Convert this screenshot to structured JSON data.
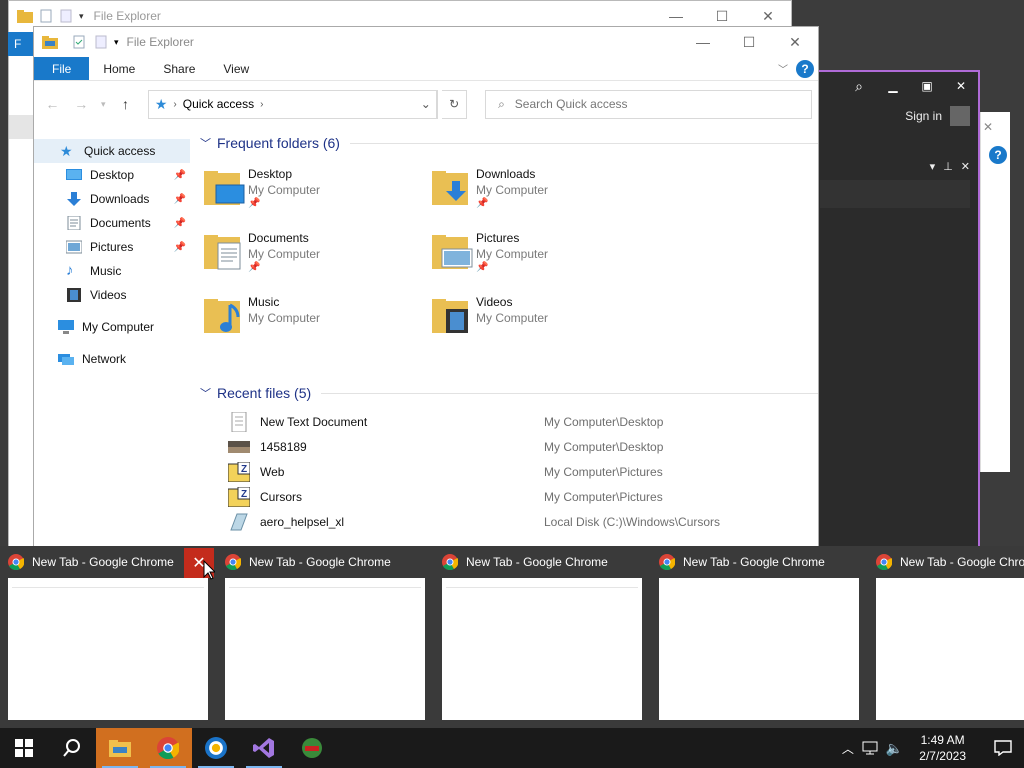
{
  "bg_window": {
    "title": "File Explorer",
    "ribbon_file_fragment": "F"
  },
  "dark_window": {
    "sign_in": "Sign in"
  },
  "window": {
    "title": "File Explorer"
  },
  "ribbon": {
    "tabs": [
      "File",
      "Home",
      "Share",
      "View"
    ]
  },
  "address": {
    "segment": "Quick access"
  },
  "search": {
    "placeholder": "Search Quick access"
  },
  "sidebar": {
    "quick_access": "Quick access",
    "items": [
      {
        "label": "Desktop",
        "icon": "desktop-icon",
        "pinned": true
      },
      {
        "label": "Downloads",
        "icon": "downloads-icon",
        "pinned": true
      },
      {
        "label": "Documents",
        "icon": "documents-icon",
        "pinned": true
      },
      {
        "label": "Pictures",
        "icon": "pictures-icon",
        "pinned": true
      },
      {
        "label": "Music",
        "icon": "music-icon",
        "pinned": false
      },
      {
        "label": "Videos",
        "icon": "videos-icon",
        "pinned": false
      }
    ],
    "my_computer": "My Computer",
    "network": "Network"
  },
  "frequent": {
    "header": "Frequent folders (6)",
    "items": [
      {
        "name": "Desktop",
        "location": "My Computer",
        "pinned": true
      },
      {
        "name": "Downloads",
        "location": "My Computer",
        "pinned": true
      },
      {
        "name": "Documents",
        "location": "My Computer",
        "pinned": true
      },
      {
        "name": "Pictures",
        "location": "My Computer",
        "pinned": true
      },
      {
        "name": "Music",
        "location": "My Computer",
        "pinned": false
      },
      {
        "name": "Videos",
        "location": "My Computer",
        "pinned": false
      }
    ]
  },
  "recent": {
    "header": "Recent files (5)",
    "items": [
      {
        "name": "New Text Document",
        "location": "My Computer\\Desktop"
      },
      {
        "name": "1458189",
        "location": "My Computer\\Desktop"
      },
      {
        "name": "Web",
        "location": "My Computer\\Pictures"
      },
      {
        "name": "Cursors",
        "location": "My Computer\\Pictures"
      },
      {
        "name": "aero_helpsel_xl",
        "location": "Local Disk (C:)\\Windows\\Cursors"
      }
    ]
  },
  "thumbnails": [
    {
      "title": "New Tab - Google Chrome"
    },
    {
      "title": "New Tab - Google Chrome"
    },
    {
      "title": "New Tab - Google Chrome"
    },
    {
      "title": "New Tab - Google Chrome"
    },
    {
      "title": "New Tab - Google Chrome"
    }
  ],
  "clock": {
    "time": "1:49 AM",
    "date": "2/7/2023"
  },
  "colors": {
    "accent": "#1979ca",
    "close": "#c42b1c",
    "header_blue": "#1e3287"
  }
}
